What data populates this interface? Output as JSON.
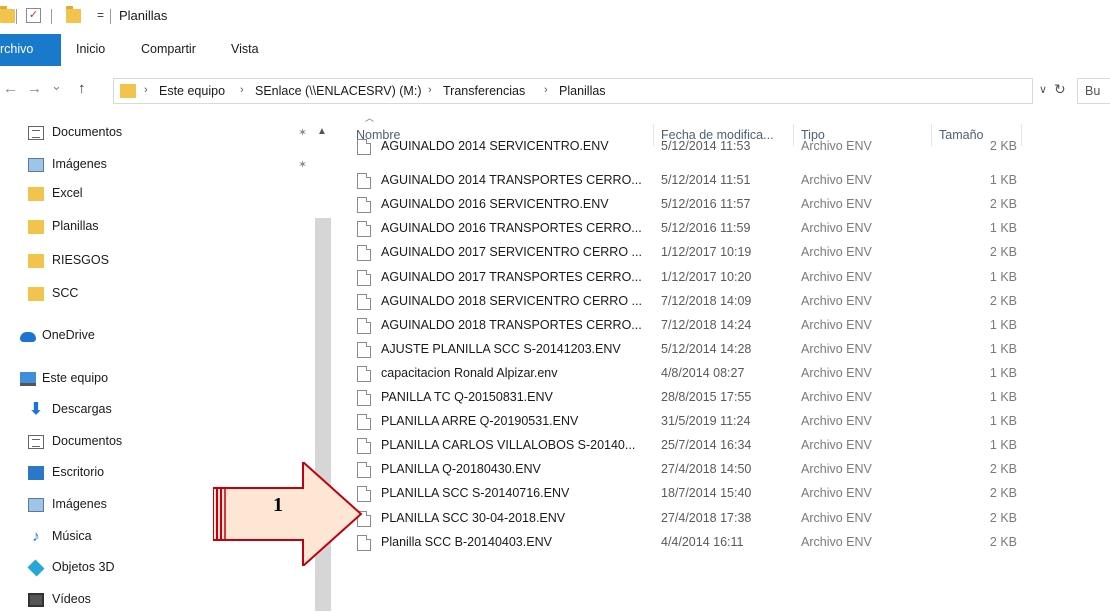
{
  "titlebar": {
    "title": "Planillas",
    "qa_arrow": "="
  },
  "ribbon": {
    "tabs": [
      "rchivo",
      "Inicio",
      "Compartir",
      "Vista"
    ]
  },
  "address": {
    "nav_back": "←",
    "nav_forward": "→",
    "nav_recent": "⌄",
    "nav_up": "↑",
    "crumbs": [
      "Este equipo",
      "SEnlace (\\\\ENLACESRV) (M:)",
      "Transferencias",
      "Planillas"
    ],
    "separator": "›",
    "dropdown": "∨",
    "refresh": "↻",
    "search_placeholder": "Bu"
  },
  "sidebar": {
    "items": [
      {
        "label": "Documentos",
        "icon": "document-icon",
        "pinned": true
      },
      {
        "label": "Imágenes",
        "icon": "image-icon",
        "pinned": true
      },
      {
        "label": "Excel",
        "icon": "folder-icon"
      },
      {
        "label": "Planillas",
        "icon": "folder-icon"
      },
      {
        "label": "RIESGOS",
        "icon": "folder-icon"
      },
      {
        "label": "SCC",
        "icon": "folder-icon"
      },
      {
        "label": "OneDrive",
        "icon": "cloud-icon"
      },
      {
        "label": "Este equipo",
        "icon": "computer-icon"
      },
      {
        "label": "Descargas",
        "icon": "download-icon"
      },
      {
        "label": "Documentos",
        "icon": "document-icon"
      },
      {
        "label": "Escritorio",
        "icon": "desktop-icon"
      },
      {
        "label": "Imágenes",
        "icon": "image-icon"
      },
      {
        "label": "Música",
        "icon": "music-icon"
      },
      {
        "label": "Objetos 3D",
        "icon": "cube-icon"
      },
      {
        "label": "Vídeos",
        "icon": "video-icon"
      }
    ]
  },
  "filelist": {
    "columns": {
      "name": "Nombre",
      "date": "Fecha de modifica...",
      "type": "Tipo",
      "size": "Tamaño"
    },
    "rows": [
      {
        "name": "AGUINALDO 2014 SERVICENTRO.ENV",
        "date": "5/12/2014 11:53",
        "type": "Archivo ENV",
        "size": "2 KB"
      },
      {
        "name": "AGUINALDO 2014 TRANSPORTES CERRO...",
        "date": "5/12/2014 11:51",
        "type": "Archivo ENV",
        "size": "1 KB"
      },
      {
        "name": "AGUINALDO 2016 SERVICENTRO.ENV",
        "date": "5/12/2016 11:57",
        "type": "Archivo ENV",
        "size": "2 KB"
      },
      {
        "name": "AGUINALDO 2016 TRANSPORTES CERRO...",
        "date": "5/12/2016 11:59",
        "type": "Archivo ENV",
        "size": "1 KB"
      },
      {
        "name": "AGUINALDO 2017 SERVICENTRO CERRO ...",
        "date": "1/12/2017 10:19",
        "type": "Archivo ENV",
        "size": "2 KB"
      },
      {
        "name": "AGUINALDO 2017 TRANSPORTES CERRO...",
        "date": "1/12/2017 10:20",
        "type": "Archivo ENV",
        "size": "1 KB"
      },
      {
        "name": "AGUINALDO 2018 SERVICENTRO CERRO ...",
        "date": "7/12/2018 14:09",
        "type": "Archivo ENV",
        "size": "2 KB"
      },
      {
        "name": "AGUINALDO 2018 TRANSPORTES CERRO...",
        "date": "7/12/2018 14:24",
        "type": "Archivo ENV",
        "size": "1 KB"
      },
      {
        "name": "AJUSTE PLANILLA SCC S-20141203.ENV",
        "date": "5/12/2014 14:28",
        "type": "Archivo ENV",
        "size": "1 KB"
      },
      {
        "name": "capacitacion Ronald Alpizar.env",
        "date": "4/8/2014 08:27",
        "type": "Archivo ENV",
        "size": "1 KB"
      },
      {
        "name": "PANILLA TC Q-20150831.ENV",
        "date": "28/8/2015 17:55",
        "type": "Archivo ENV",
        "size": "1 KB"
      },
      {
        "name": "PLANILLA ARRE Q-20190531.ENV",
        "date": "31/5/2019 11:24",
        "type": "Archivo ENV",
        "size": "1 KB"
      },
      {
        "name": "PLANILLA CARLOS VILLALOBOS S-20140...",
        "date": "25/7/2014 16:34",
        "type": "Archivo ENV",
        "size": "1 KB"
      },
      {
        "name": "PLANILLA Q-20180430.ENV",
        "date": "27/4/2018 14:50",
        "type": "Archivo ENV",
        "size": "2 KB"
      },
      {
        "name": "PLANILLA SCC  S-20140716.ENV",
        "date": "18/7/2014 15:40",
        "type": "Archivo ENV",
        "size": "2 KB"
      },
      {
        "name": "PLANILLA SCC 30-04-2018.ENV",
        "date": "27/4/2018 17:38",
        "type": "Archivo ENV",
        "size": "2 KB"
      },
      {
        "name": "Planilla SCC B-20140403.ENV",
        "date": "4/4/2014 16:11",
        "type": "Archivo ENV",
        "size": "2 KB"
      }
    ]
  },
  "annotation": {
    "label": "1",
    "fill": "#fde7d4",
    "stroke": "#c0000f"
  }
}
